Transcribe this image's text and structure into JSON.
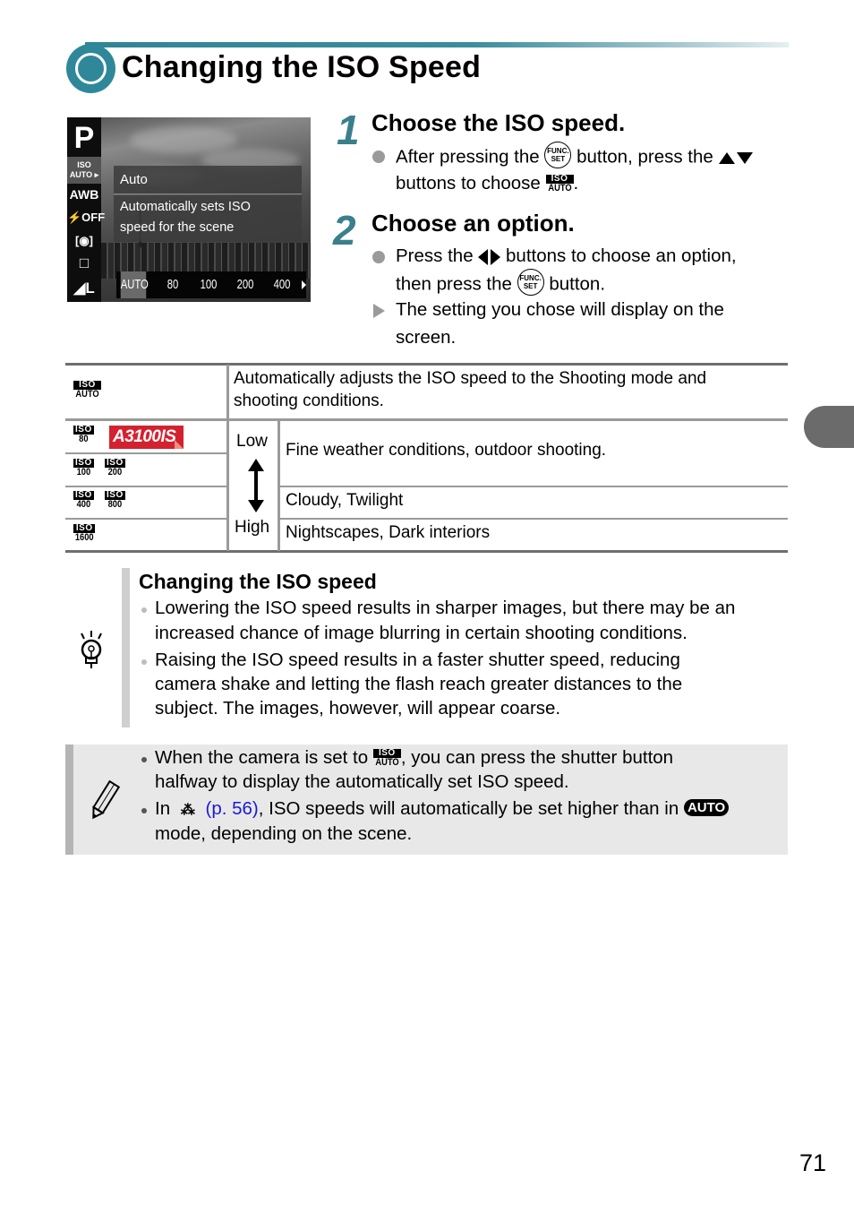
{
  "header": {
    "title": "Changing the ISO Speed",
    "accent_color": "#2f8899"
  },
  "camera_screen": {
    "mode": "P",
    "left_menu": [
      "ISO AUTO",
      "AWB",
      "Flash OFF",
      "Metering",
      "Drive",
      "Image size L"
    ],
    "popup_title": "Auto",
    "popup_desc_line1": "Automatically sets ISO",
    "popup_desc_line2": "speed for the scene",
    "options": [
      "AUTO",
      "80",
      "100",
      "200",
      "400"
    ],
    "selected_option": "AUTO"
  },
  "steps": [
    {
      "number": "1",
      "title": "Choose the ISO speed.",
      "line1_a": "After pressing the",
      "line1_b": "button, press the",
      "line2_a": "buttons to choose",
      "line2_b": "."
    },
    {
      "number": "2",
      "title": "Choose an option.",
      "line1_a": "Press the",
      "line1_b": "buttons to choose an option,",
      "line2_a": "then press the",
      "line2_b": "button.",
      "result_line1": "The setting you chose will display on the",
      "result_line2": "screen."
    }
  ],
  "icons": {
    "func_top": "FUNC.",
    "func_bot": "SET",
    "iso_top": "ISO",
    "iso_auto": "AUTO"
  },
  "table": {
    "auto_row": {
      "iso": "AUTO",
      "desc_line1": "Automatically adjusts the ISO speed to the Shooting mode and",
      "desc_line2": "shooting conditions."
    },
    "rows": [
      {
        "isos": [
          "80"
        ],
        "badge": "A3100IS"
      },
      {
        "isos": [
          "100",
          "200"
        ]
      },
      {
        "isos": [
          "400",
          "800"
        ]
      },
      {
        "isos": [
          "1600"
        ]
      }
    ],
    "scale_low": "Low",
    "scale_high": "High",
    "descriptions": [
      "Fine weather conditions, outdoor shooting.",
      "Cloudy, Twilight",
      "Nightscapes, Dark interiors"
    ]
  },
  "tip": {
    "title": "Changing the ISO speed",
    "bullet1_line1": "Lowering the ISO speed results in sharper images, but there may be an",
    "bullet1_line2": "increased chance of image blurring in certain shooting conditions.",
    "bullet2_line1": "Raising the ISO speed results in a faster shutter speed, reducing",
    "bullet2_line2": "camera shake and letting the flash reach greater distances to the",
    "bullet2_line3": "subject. The images, however, will appear coarse."
  },
  "note": {
    "bullet1_a": "When the camera is set to",
    "bullet1_b": ", you can press the shutter button",
    "bullet1_line2": "halfway to display the automatically set ISO speed.",
    "bullet2_a": "In",
    "bullet2_link": "(p. 56)",
    "bullet2_b": ", ISO speeds will automatically be set higher than in",
    "bullet2_badge": "AUTO",
    "bullet2_line2": "mode, depending on the scene."
  },
  "page_number": "71"
}
